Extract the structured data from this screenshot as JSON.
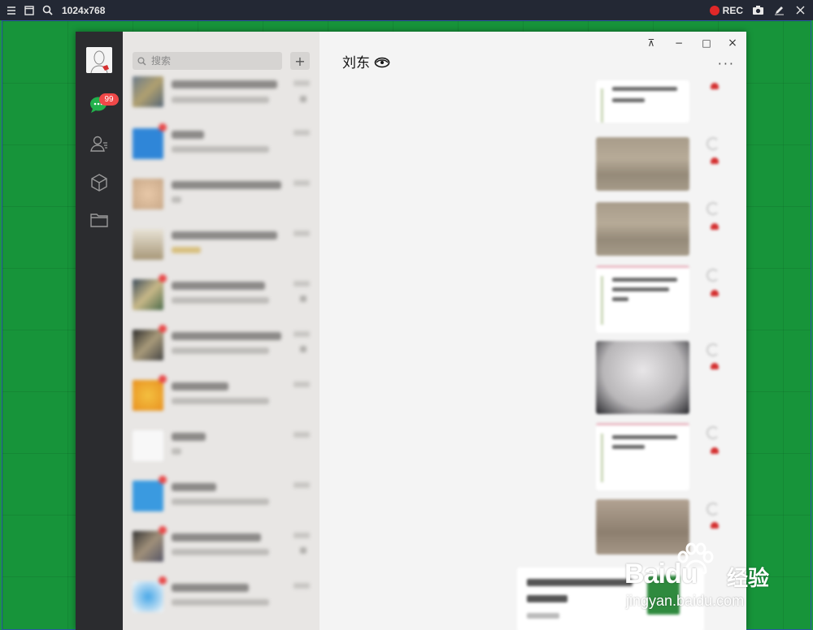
{
  "recorder": {
    "resolution": "1024x768",
    "rec_label": "REC"
  },
  "wechat": {
    "nav": {
      "unread_badge": "99"
    },
    "search": {
      "placeholder": "搜索"
    },
    "add_label": "+",
    "chat": {
      "title": "刘东",
      "more": "···"
    },
    "window_controls": {
      "pin": "⊼",
      "minimize": "−",
      "maximize": "□",
      "close": "×"
    }
  },
  "watermark": {
    "brand": "Baidu",
    "brand_cn": "经验",
    "url": "jingyan.baidu.com"
  },
  "colors": {
    "nav_bg": "#2b2c2f",
    "badge": "#f04848",
    "desktop": "#17943a"
  }
}
